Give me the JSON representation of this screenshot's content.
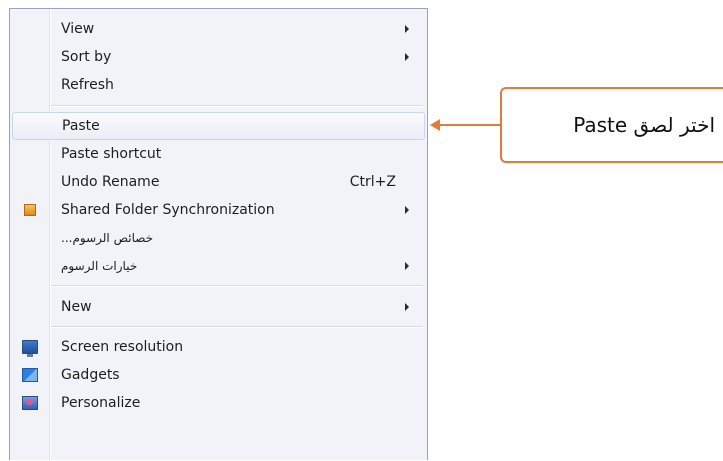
{
  "context_menu": {
    "items": [
      {
        "label": "View",
        "submenu": true
      },
      {
        "label": "Sort by",
        "submenu": true
      },
      {
        "label": "Refresh"
      },
      {
        "label": "Paste",
        "highlighted": true
      },
      {
        "label": "Paste shortcut"
      },
      {
        "label": "Undo Rename",
        "shortcut": "Ctrl+Z"
      },
      {
        "label": "Shared Folder Synchronization",
        "submenu": true,
        "icon": "sync-folder-icon"
      },
      {
        "label": "...خصائص الرسوم"
      },
      {
        "label": "خيارات الرسوم",
        "submenu": true
      },
      {
        "label": "New",
        "submenu": true
      },
      {
        "label": "Screen resolution",
        "icon": "screen-resolution-icon"
      },
      {
        "label": "Gadgets",
        "icon": "gadgets-icon"
      },
      {
        "label": "Personalize",
        "icon": "personalize-icon"
      }
    ]
  },
  "annotation": {
    "text": "اختر لصق Paste",
    "color": "#e07b39"
  }
}
